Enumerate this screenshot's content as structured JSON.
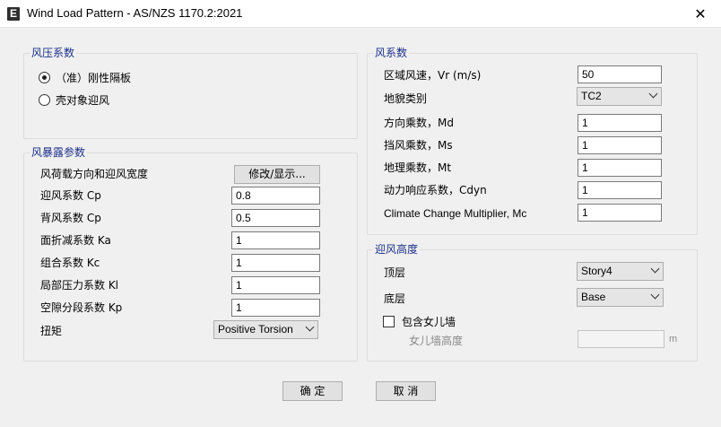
{
  "window": {
    "title": "Wind Load Pattern - AS/NZS 1170.2:2021",
    "app_icon": "E",
    "close_glyph": "✕"
  },
  "wind_pressure_coeff": {
    "title": "风压系数",
    "options": [
      {
        "label": "（准）刚性隔板",
        "selected": true
      },
      {
        "label": "壳对象迎风",
        "selected": false
      }
    ]
  },
  "exposure_params": {
    "title": "风暴露参数",
    "direction_label": "风荷载方向和迎风宽度",
    "modify_button": "修改/显示...",
    "cp_windward_label": "迎风系数 Cp",
    "cp_windward_value": "0.8",
    "cp_leeward_label": "背风系数 Cp",
    "cp_leeward_value": "0.5",
    "ka_label": "面折减系数 Ka",
    "ka_value": "1",
    "kc_label": "组合系数 Kc",
    "kc_value": "1",
    "kl_label": "局部压力系数 Kl",
    "kl_value": "1",
    "kp_label": "空隙分段系数 Kp",
    "kp_value": "1",
    "torsion_label": "扭矩",
    "torsion_value": "Positive Torsion"
  },
  "wind_coeff": {
    "title": "风系数",
    "vr_label": "区域风速，Vr (m/s)",
    "vr_value": "50",
    "terrain_label": "地貌类别",
    "terrain_value": "TC2",
    "md_label": "方向乘数，Md",
    "md_value": "1",
    "ms_label": "挡风乘数，Ms",
    "ms_value": "1",
    "mt_label": "地理乘数，Mt",
    "mt_value": "1",
    "cdyn_label": "动力响应系数，Cdyn",
    "cdyn_value": "1",
    "mc_label": "Climate Change Multiplier, Mc",
    "mc_value": "1"
  },
  "exposure_height": {
    "title": "迎风高度",
    "top_label": "顶层",
    "top_value": "Story4",
    "bottom_label": "底层",
    "bottom_value": "Base",
    "parapet_label": "包含女儿墙",
    "parapet_checked": false,
    "parapet_height_label": "女儿墙高度",
    "parapet_height_value": "",
    "parapet_height_unit": "m"
  },
  "footer": {
    "ok_label": "确 定",
    "cancel_label": "取 消"
  }
}
